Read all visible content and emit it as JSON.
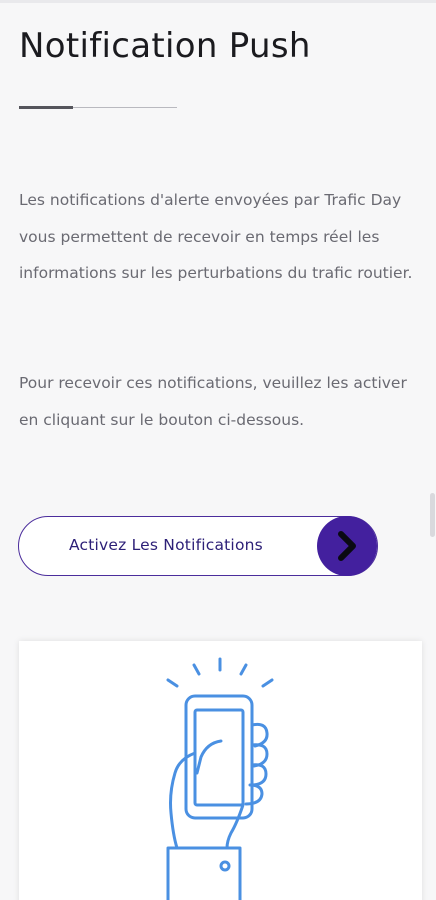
{
  "header": {
    "title": "Notification Push"
  },
  "content": {
    "paragraph_1": "Les notifications d'alerte envoyées par Trafic Day vous permettent de recevoir en temps réel les informations sur les perturbations du trafic routier.",
    "paragraph_2": "Pour recevoir ces notifications, veuillez les activer en cliquant sur le bouton ci-dessous."
  },
  "cta": {
    "label": "Activez Les Notifications",
    "icon": "chevron-right-icon"
  },
  "illustration": {
    "icon": "phone-notification-icon"
  },
  "colors": {
    "accent": "#43209e",
    "button_text": "#2c1f77",
    "illustration_stroke": "#4a90e2",
    "body_text": "#6a6a72"
  }
}
